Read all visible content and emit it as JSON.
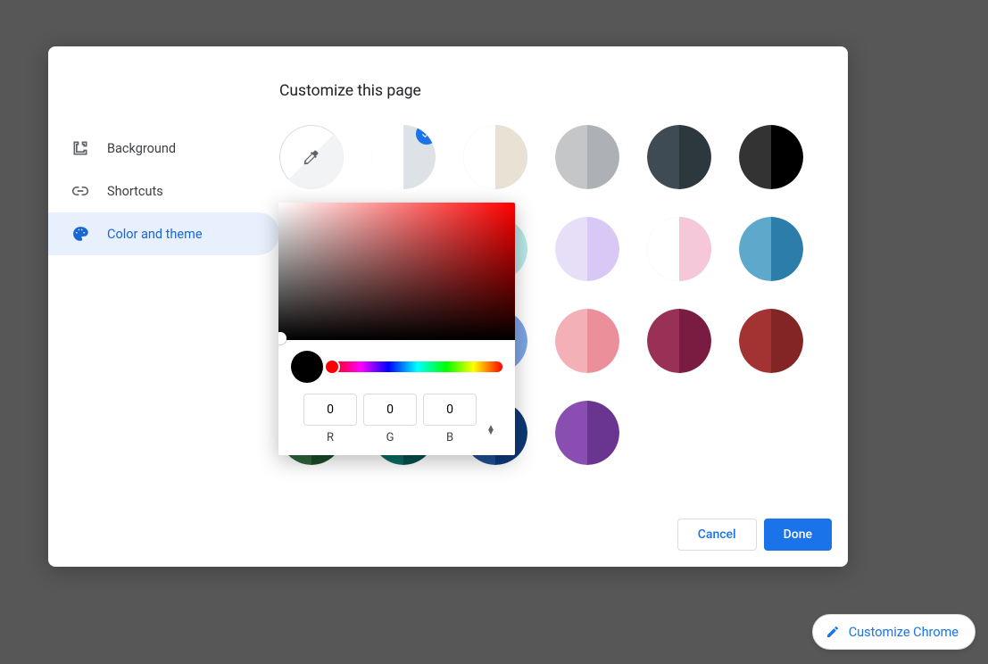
{
  "dialog": {
    "title": "Customize this page",
    "sidebar": {
      "items": [
        {
          "label": "Background"
        },
        {
          "label": "Shortcuts"
        },
        {
          "label": "Color and theme",
          "selected": true
        }
      ]
    },
    "swatches": [
      {
        "type": "eyedropper"
      },
      {
        "left": "#ffffff",
        "right": "#dee1e6",
        "selected": true
      },
      {
        "left": "#ffffff",
        "right": "#e8e1d4"
      },
      {
        "left": "#c5c6c8",
        "right": "#adb0b4"
      },
      {
        "left": "#3e4b54",
        "right": "#2d373e"
      },
      {
        "left": "#333333",
        "right": "#000000"
      },
      {
        "left": "#cde7ee",
        "right": "#a9e0c8"
      },
      {
        "left": "#cde8d8",
        "right": "#a6d98c"
      },
      {
        "left": "#e0f3f3",
        "right": "#b8e7e7"
      },
      {
        "left": "#e6dff7",
        "right": "#d8c8f5"
      },
      {
        "left": "#ffffff",
        "right": "#f5c7d9"
      },
      {
        "left": "#5ea8cc",
        "right": "#2c7da9"
      },
      {
        "left": "#8bb77f",
        "right": "#5d9952"
      },
      {
        "left": "#91cec8",
        "right": "#5cb3ab"
      },
      {
        "left": "#a8c4f0",
        "right": "#7da4e4"
      },
      {
        "left": "#f3b0b6",
        "right": "#eb909b"
      },
      {
        "left": "#993055",
        "right": "#7a1c41"
      },
      {
        "left": "#a33332",
        "right": "#822524"
      },
      {
        "left": "#2d663b",
        "right": "#1c4a28"
      },
      {
        "left": "#0e6a64",
        "right": "#03504b"
      },
      {
        "left": "#1f4f93",
        "right": "#0e3876"
      },
      {
        "left": "#8a4db2",
        "right": "#6a3590"
      }
    ],
    "buttons": {
      "cancel": "Cancel",
      "done": "Done"
    }
  },
  "color_picker": {
    "current_hex": "#000000",
    "r": "0",
    "g": "0",
    "b": "0",
    "labels": {
      "r": "R",
      "g": "G",
      "b": "B"
    }
  },
  "customize_chip": {
    "label": "Customize Chrome"
  }
}
